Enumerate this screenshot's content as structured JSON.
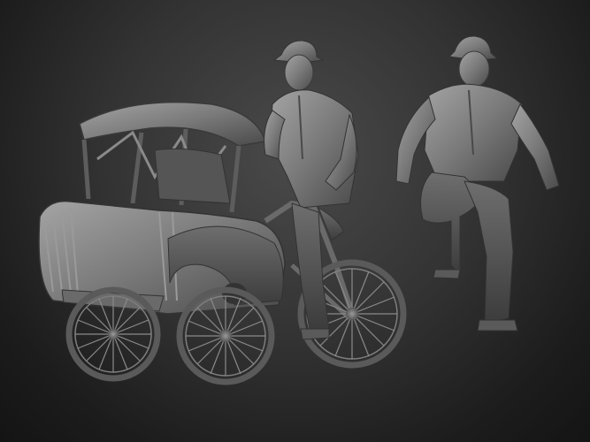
{
  "scene": {
    "background_top": "#4a4a4a",
    "background_bottom": "#141414",
    "clay_color": "#7a7a7a",
    "clay_shadow": "#3a3a3a",
    "clay_highlight": "#a8a8a8",
    "objects": [
      "pedicab-model",
      "rider-figure",
      "standing-figure"
    ]
  }
}
